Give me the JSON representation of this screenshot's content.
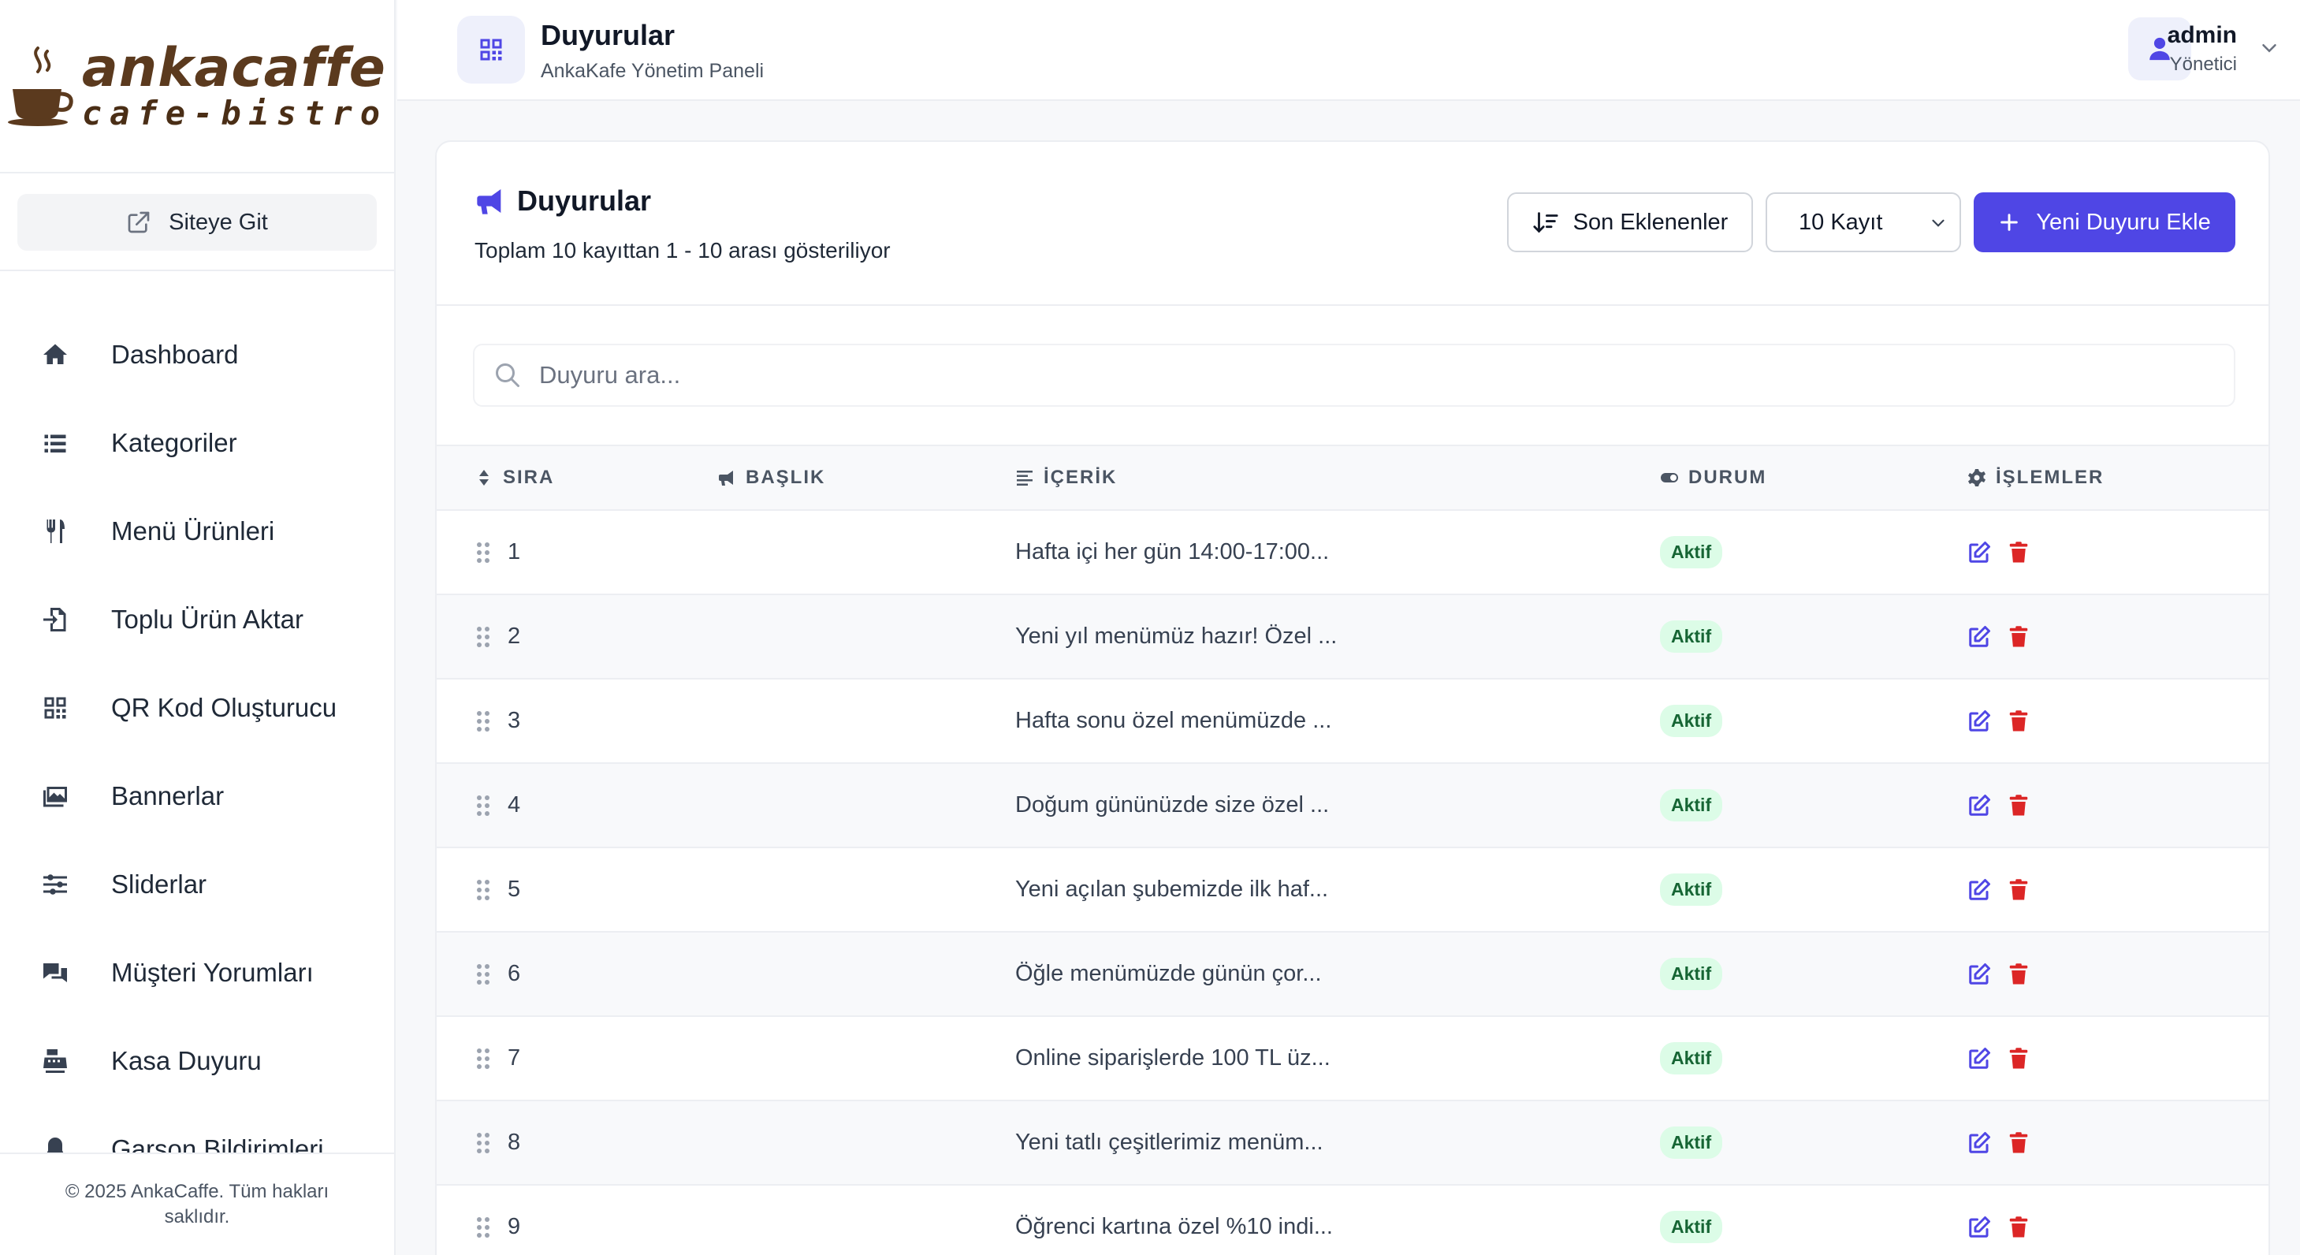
{
  "brand": {
    "logo_main": "ankacaffe",
    "logo_sub": "cafe-bistro"
  },
  "sidebar": {
    "site_link": "Siteye Git",
    "items": [
      {
        "label": "Dashboard",
        "icon": "home-icon"
      },
      {
        "label": "Kategoriler",
        "icon": "list-icon"
      },
      {
        "label": "Menü Ürünleri",
        "icon": "utensils-icon"
      },
      {
        "label": "Toplu Ürün Aktar",
        "icon": "file-import-icon"
      },
      {
        "label": "QR Kod Oluşturucu",
        "icon": "qrcode-icon"
      },
      {
        "label": "Bannerlar",
        "icon": "images-icon"
      },
      {
        "label": "Sliderlar",
        "icon": "sliders-icon"
      },
      {
        "label": "Müşteri Yorumları",
        "icon": "comments-icon"
      },
      {
        "label": "Kasa Duyuru",
        "icon": "cash-register-icon"
      },
      {
        "label": "Garson Bildirimleri",
        "icon": "bell-icon"
      }
    ],
    "footer": "© 2025 AnkaCaffe. Tüm hakları saklıdır."
  },
  "header": {
    "title": "Duyurular",
    "subtitle": "AnkaKafe Yönetim Paneli",
    "user_name": "admin",
    "user_role": "Yönetici"
  },
  "card": {
    "title": "Duyurular",
    "summary": "Toplam 10 kayıttan 1 - 10 arası gösteriliyor",
    "sort_label": "Son Eklenenler",
    "per_page": "10 Kayıt",
    "add_label": "Yeni Duyuru Ekle",
    "search_placeholder": "Duyuru ara..."
  },
  "table": {
    "columns": [
      "SIRA",
      "BAŞLIK",
      "İÇERİK",
      "DURUM",
      "İŞLEMLER"
    ],
    "rows": [
      {
        "order": "1",
        "title": "",
        "content": "Hafta içi her gün 14:00-17:00...",
        "status": "Aktif"
      },
      {
        "order": "2",
        "title": "",
        "content": "Yeni yıl menümüz hazır! Özel ...",
        "status": "Aktif"
      },
      {
        "order": "3",
        "title": "",
        "content": "Hafta sonu özel menümüzde ...",
        "status": "Aktif"
      },
      {
        "order": "4",
        "title": "",
        "content": "Doğum gününüzde size özel ...",
        "status": "Aktif"
      },
      {
        "order": "5",
        "title": "",
        "content": "Yeni açılan şubemizde ilk haf...",
        "status": "Aktif"
      },
      {
        "order": "6",
        "title": "",
        "content": "Öğle menümüzde günün çor...",
        "status": "Aktif"
      },
      {
        "order": "7",
        "title": "",
        "content": "Online siparişlerde 100 TL üz...",
        "status": "Aktif"
      },
      {
        "order": "8",
        "title": "",
        "content": "Yeni tatlı çeşitlerimiz menüm...",
        "status": "Aktif"
      },
      {
        "order": "9",
        "title": "",
        "content": "Öğrenci kartına özel %10 indi...",
        "status": "Aktif"
      }
    ]
  },
  "colors": {
    "accent": "#4f46e5",
    "danger": "#dc2626",
    "success_bg": "#dcfce7",
    "success_text": "#166534",
    "logo_brown": "#5b3a1e"
  }
}
